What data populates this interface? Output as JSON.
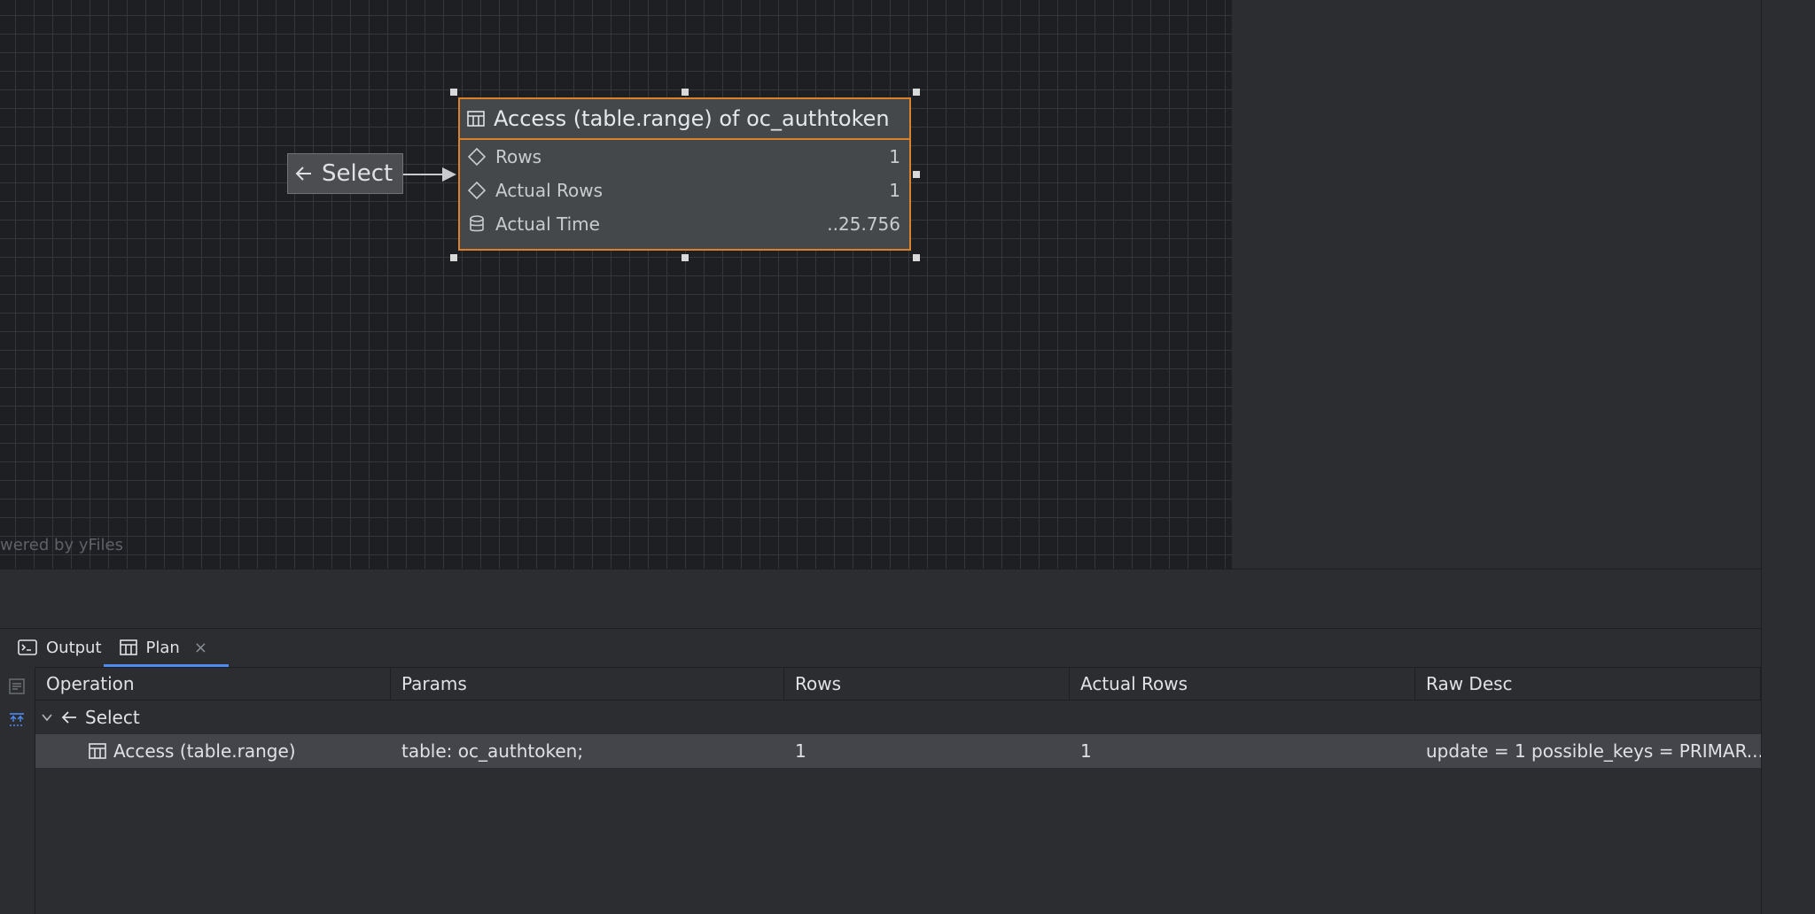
{
  "canvas": {
    "watermark": "wered by yFiles",
    "select_node": {
      "label": "Select",
      "icon": "select-arrow-icon"
    },
    "access_node": {
      "title": "Access (table.range) of oc_authtoken",
      "icon": "table-icon",
      "accent": "#d9822b",
      "rows": [
        {
          "label": "Rows",
          "value": "1",
          "icon": "diamond-icon"
        },
        {
          "label": "Actual Rows",
          "value": "1",
          "icon": "diamond-icon"
        },
        {
          "label": "Actual Time",
          "value": "..25.756",
          "icon": "database-icon"
        }
      ]
    }
  },
  "tabs": [
    {
      "label": "Output",
      "icon": "console-icon"
    },
    {
      "label": "Plan",
      "icon": "table-icon",
      "close": "×"
    }
  ],
  "table": {
    "columns": [
      "Operation",
      "Params",
      "Rows",
      "Actual Rows",
      "Raw Desc"
    ],
    "rows": [
      {
        "operation": "Select",
        "params": "",
        "rows": "",
        "actual_rows": "",
        "raw_desc": ""
      },
      {
        "operation": "Access (table.range)",
        "params": "table: oc_authtoken;",
        "rows": "1",
        "actual_rows": "1",
        "raw_desc": "update = 1 possible_keys = PRIMAR..."
      }
    ]
  }
}
